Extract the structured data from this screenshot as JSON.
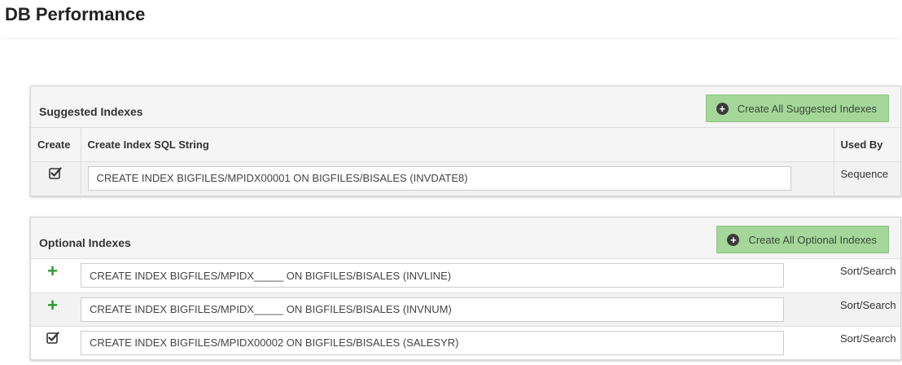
{
  "page": {
    "title": "DB Performance"
  },
  "suggested": {
    "title": "Suggested Indexes",
    "button_label": "Create All Suggested Indexes",
    "columns": {
      "create": "Create",
      "sql": "Create Index SQL String",
      "used_by": "Used By"
    },
    "rows": [
      {
        "icon": "checkbox-checked-icon",
        "sql": "CREATE INDEX BIGFILES/MPIDX00001 ON BIGFILES/BISALES (INVDATE8)",
        "used_by": "Sequence"
      }
    ]
  },
  "optional": {
    "title": "Optional Indexes",
    "button_label": "Create All Optional Indexes",
    "rows": [
      {
        "icon": "plus-icon",
        "sql": "CREATE INDEX BIGFILES/MPIDX_____ ON BIGFILES/BISALES (INVLINE)",
        "used_by": "Sort/Search"
      },
      {
        "icon": "plus-icon",
        "sql": "CREATE INDEX BIGFILES/MPIDX_____ ON BIGFILES/BISALES (INVNUM)",
        "used_by": "Sort/Search"
      },
      {
        "icon": "checkbox-checked-icon",
        "sql": "CREATE INDEX BIGFILES/MPIDX00002 ON BIGFILES/BISALES (SALESYR)",
        "used_by": "Sort/Search"
      }
    ]
  },
  "colors": {
    "plus_green": "#2e9a2e",
    "button_green": "#a5d69a"
  }
}
